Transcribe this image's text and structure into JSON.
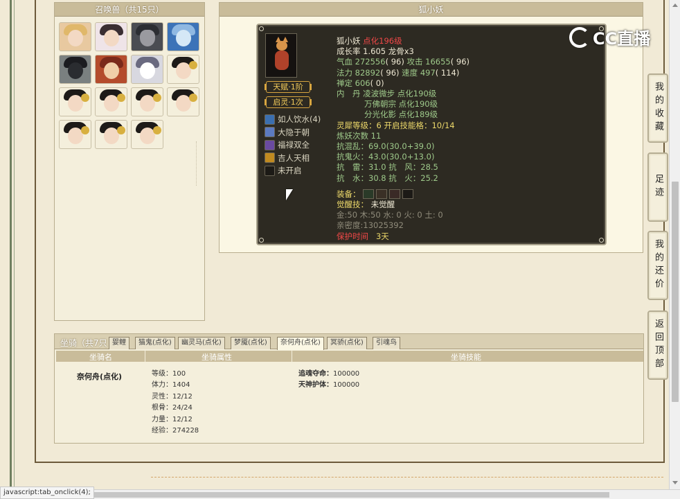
{
  "pet_list": {
    "title": "召唤兽（共15只）",
    "pets": [
      {
        "icon": "golden-haired-girl-avatar-icon",
        "style": "av-gold"
      },
      {
        "icon": "white-robed-girl-avatar-icon",
        "style": "av-white"
      },
      {
        "icon": "wolf-avatar-icon",
        "style": "av-wolf"
      },
      {
        "icon": "ice-spirit-avatar-icon",
        "style": "av-ice"
      },
      {
        "icon": "dark-beast-avatar-icon",
        "style": "av-dark"
      },
      {
        "icon": "orange-warrior-avatar-icon",
        "style": "av-orange"
      },
      {
        "icon": "masked-spirit-avatar-icon",
        "style": "av-mask"
      },
      {
        "icon": "fox-girl-avatar-icon",
        "style": "av-girl"
      },
      {
        "icon": "fox-girl-avatar-icon",
        "style": "av-girl"
      },
      {
        "icon": "fox-girl-avatar-icon",
        "style": "av-girl"
      },
      {
        "icon": "fox-girl-avatar-icon",
        "style": "av-girl"
      },
      {
        "icon": "fox-girl-avatar-icon",
        "style": "av-girl"
      },
      {
        "icon": "fox-girl-avatar-icon",
        "style": "av-girl"
      },
      {
        "icon": "fox-girl-avatar-icon",
        "style": "av-girl"
      },
      {
        "icon": "fox-girl-avatar-icon",
        "style": "av-girl"
      }
    ]
  },
  "detail": {
    "title": "狐小妖",
    "badges": {
      "talent": "天赋·1阶",
      "qiling": "启灵·1次"
    },
    "skills": [
      {
        "label": "如人饮水(4)",
        "icon": "water-skill-icon",
        "color": "#3b6fb0"
      },
      {
        "label": "大隐于朝",
        "icon": "hermit-skill-icon",
        "color": "#5c7ac0"
      },
      {
        "label": "福禄双全",
        "icon": "fortune-skill-icon",
        "color": "#6a4aa0"
      },
      {
        "label": "吉人天相",
        "icon": "luck-skill-icon",
        "color": "#c08a20"
      },
      {
        "label": "未开启",
        "icon": "locked-skill-icon",
        "color": "#1c1a16"
      }
    ],
    "stats": {
      "name": "狐小妖",
      "level": "点化196级",
      "growth_label": "成长率",
      "growth": "1.605",
      "dragon_bone": "龙骨x3",
      "hp_label": "气血",
      "hp": "272556",
      "hp_paren": "( 96)",
      "atk_label": "攻击",
      "atk": "16655",
      "atk_paren": "( 96)",
      "mp_label": "法力",
      "mp": "82892",
      "mp_paren": "( 96)",
      "spd_label": "速度",
      "spd": "497",
      "spd_paren": "( 114)",
      "ding_label": "禅定",
      "ding": "606",
      "ding_paren": "( 0)",
      "neidan_label": "内　丹",
      "neidan_1": "凌波微步 点化190级",
      "neidan_2": "万佛朝宗 点化190级",
      "neidan_3": "分光化影 点化189级",
      "lingxi": "灵犀等级：",
      "lingxi_val": "6 开启技能格：",
      "lingxi_slots": "10/14",
      "lianyao_label": "炼妖次数",
      "lianyao": "11",
      "res_1_label": "抗混乱：",
      "res_1": "69.0",
      "res_1_detail": "(30.0+39.0)",
      "res_2_label": "抗鬼火：",
      "res_2": "43.0",
      "res_2_detail": "(30.0+13.0)",
      "res_3": "抗　雷：31.0  抗　风：28.5",
      "res_4": "抗　水：30.8  抗　火：25.2",
      "equip_label": "装备：",
      "awaken_label": "觉醒技：",
      "awaken_val": "未觉醒",
      "elements": "金:50  木:50  水: 0  火: 0  土: 0",
      "intimacy": "亲密度:13025392",
      "protect_label": "保护时间",
      "protect_val": "3天"
    }
  },
  "mount": {
    "label": "坐骑（共7只",
    "tabs": [
      "婴鲤",
      "猫鬼(点化)",
      "幽灵马(点化)",
      "梦魇(点化)",
      "奈何舟(点化)",
      "冥骄(点化)",
      "引魂鸟"
    ],
    "active_tab": 4,
    "headers": [
      "坐骑名",
      "坐骑属性",
      "坐骑技能"
    ],
    "name": "奈何舟(点化)",
    "attrs": [
      "等级：100",
      "体力：1404",
      "灵性：12/12",
      "根骨：24/24",
      "力量：12/12",
      "经验：274228"
    ],
    "skills": [
      {
        "name": "追魂夺命：",
        "value": "100000"
      },
      {
        "name": "天神护体：",
        "value": "100000"
      }
    ]
  },
  "side_nav": {
    "favorites": "我的收藏",
    "footprints": "足迹",
    "bargain": "我的还价",
    "back_top": "返回顶部"
  },
  "status_bar": "javascript:tab_onclick(4);",
  "watermark": "CC直播"
}
